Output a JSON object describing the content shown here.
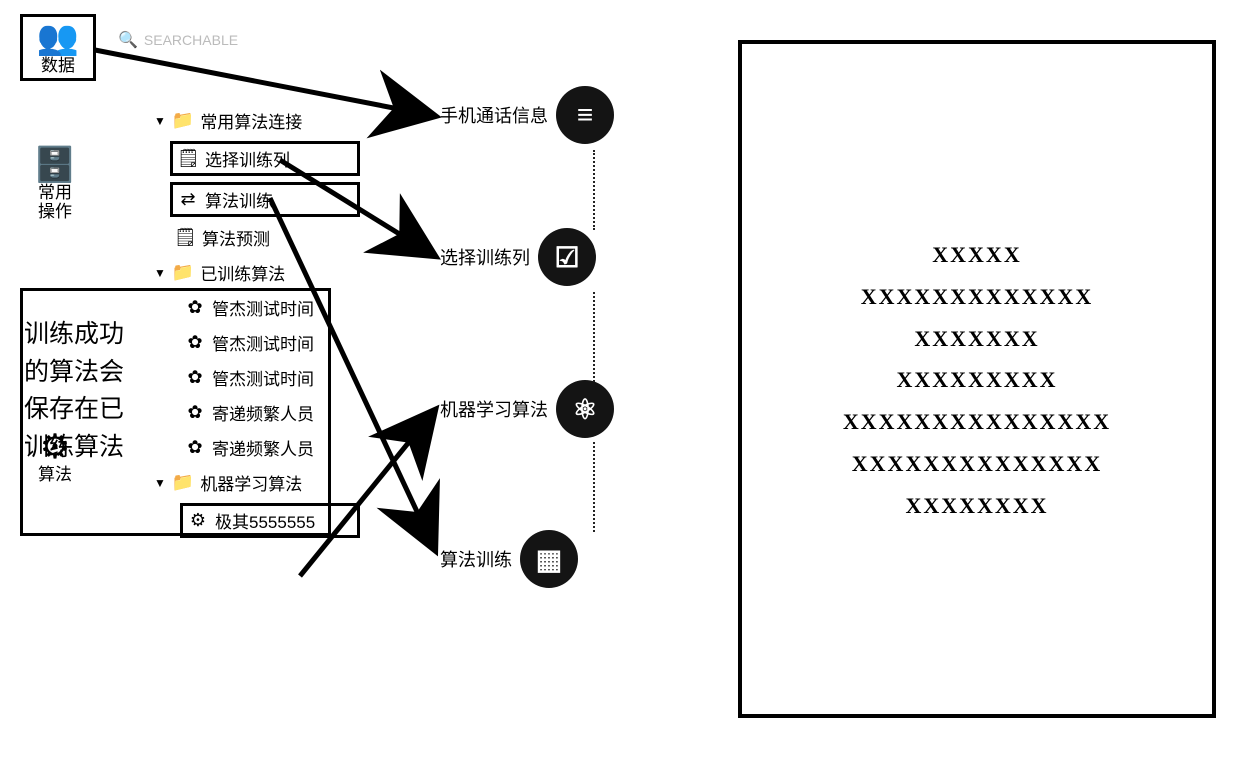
{
  "search": {
    "placeholder": "SEARCHABLE"
  },
  "sidebar": {
    "data": {
      "glyph": "👥",
      "label": "数据"
    },
    "common": {
      "glyph": "🗄️",
      "label": "常用\n操作"
    },
    "algo": {
      "glyph": "⚙",
      "label": "算法"
    }
  },
  "tree": {
    "root": {
      "label": "常用算法连接",
      "children": [
        {
          "id": "select_cols",
          "icon": "🗒",
          "label": "选择训练列",
          "boxed": true
        },
        {
          "id": "train",
          "icon": "⇄",
          "label": "算法训练",
          "boxed": true
        },
        {
          "id": "predict",
          "icon": "🗒",
          "label": "算法预测",
          "boxed": false
        }
      ]
    },
    "trained": {
      "label": "已训练算法",
      "children": [
        {
          "icon": "✿",
          "label": "管杰测试时间"
        },
        {
          "icon": "✿",
          "label": "管杰测试时间"
        },
        {
          "icon": "✿",
          "label": "管杰测试时间"
        },
        {
          "icon": "✿",
          "label": "寄递频繁人员"
        },
        {
          "icon": "✿",
          "label": "寄递频繁人员"
        }
      ]
    },
    "ml": {
      "label": "机器学习算法",
      "children": [
        {
          "icon": "⚙",
          "label": "极其5555555",
          "boxed": true
        }
      ]
    }
  },
  "annotation": "训练成功的算法会保存在已训练算法",
  "workflow": [
    {
      "id": "phone_info",
      "glyph": "≡",
      "label": "手机通话信息"
    },
    {
      "id": "select_cols",
      "glyph": "☑",
      "label": "选择训练列"
    },
    {
      "id": "ml_algo",
      "glyph": "⚛",
      "label": "机器学习算法"
    },
    {
      "id": "algo_train",
      "glyph": "▦",
      "label": "算法训练"
    }
  ],
  "right_panel_lines": [
    "XXXXX",
    "XXXXXXXXXXXXX",
    "XXXXXXX",
    "XXXXXXXXX",
    "XXXXXXXXXXXXXXX",
    "XXXXXXXXXXXXXX",
    "XXXXXXXX"
  ]
}
